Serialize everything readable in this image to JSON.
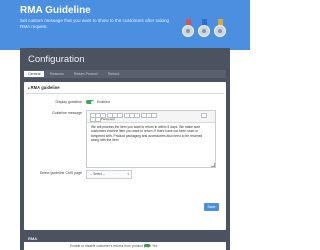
{
  "banner": {
    "title": "RMA Guideline",
    "subtitle": "Set custom message that you want to show to the customers after raising RMA request."
  },
  "config": {
    "title": "Configuration",
    "tabs": [
      {
        "label": "General"
      },
      {
        "label": "Reasons"
      },
      {
        "label": "Return Product"
      },
      {
        "label": "Refund"
      }
    ]
  },
  "panel": {
    "heading": "RMA guideline",
    "display_label": "Display guideline",
    "display_value": "Enabled",
    "message_label": "Guideline message",
    "toolbar": {
      "paragraph": "Paragraph"
    },
    "message_text": "We will process the item you want to return in within 5 days. We make sure customers that the item you want to return, if there have not been used or tampered with. Product packaging and accessories also need to be returned along with the item.",
    "cms_label": "Select guideline CMS page",
    "cms_value": "-- Select --",
    "save_label": "Save"
  },
  "bottom": {
    "heading": "RMA",
    "text": "Enable or disable customer's returns from product page",
    "toggle_value": "Yes"
  }
}
